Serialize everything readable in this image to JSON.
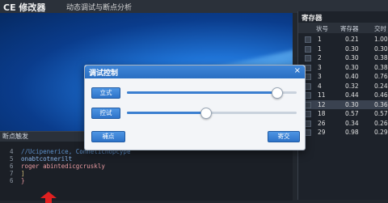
{
  "app": {
    "title": "CE 修改器",
    "subtitle": "动态调试与断点分析"
  },
  "breakpoint_panel": {
    "title": "断点触发",
    "line_numbers": [
      "4",
      "5",
      "6",
      "7",
      "6"
    ],
    "code_lines": [
      "//Ucipenerice, Conneticnopcype",
      "onabtcotnerilt",
      "roger abintedicgcruskly",
      "]",
      "}"
    ]
  },
  "register_panel": {
    "title": "寄存器",
    "columns": [
      "状号",
      "寄存器",
      "交时"
    ],
    "rows": [
      {
        "id": "1",
        "reg": "0.21",
        "val": "1.00"
      },
      {
        "id": "1",
        "reg": "0.30",
        "val": "0.30"
      },
      {
        "id": "2",
        "reg": "0.30",
        "val": "0.38"
      },
      {
        "id": "3",
        "reg": "0.30",
        "val": "0.38"
      },
      {
        "id": "3",
        "reg": "0.40",
        "val": "0.76"
      },
      {
        "id": "4",
        "reg": "0.32",
        "val": "0.24"
      },
      {
        "id": "11",
        "reg": "0.44",
        "val": "0.46"
      },
      {
        "id": "12",
        "reg": "0.30",
        "val": "0.36"
      },
      {
        "id": "18",
        "reg": "0.57",
        "val": "0.57"
      },
      {
        "id": "26",
        "reg": "0.34",
        "val": "0.26"
      },
      {
        "id": "29",
        "reg": "0.98",
        "val": "0.29"
      }
    ],
    "selected_row": 7
  },
  "dialog": {
    "title": "调试控制",
    "close_glyph": "×",
    "slider1_label": "立式",
    "slider1_value": 0.88,
    "slider2_label": "控试",
    "slider2_value": 0.46,
    "left_button": "補点",
    "right_button": "寄交"
  },
  "colors": {
    "accent": "#2d73c9",
    "annotation_arrow": "#e02020"
  },
  "icons": {
    "annotation": "red-up-arrow-icon"
  }
}
